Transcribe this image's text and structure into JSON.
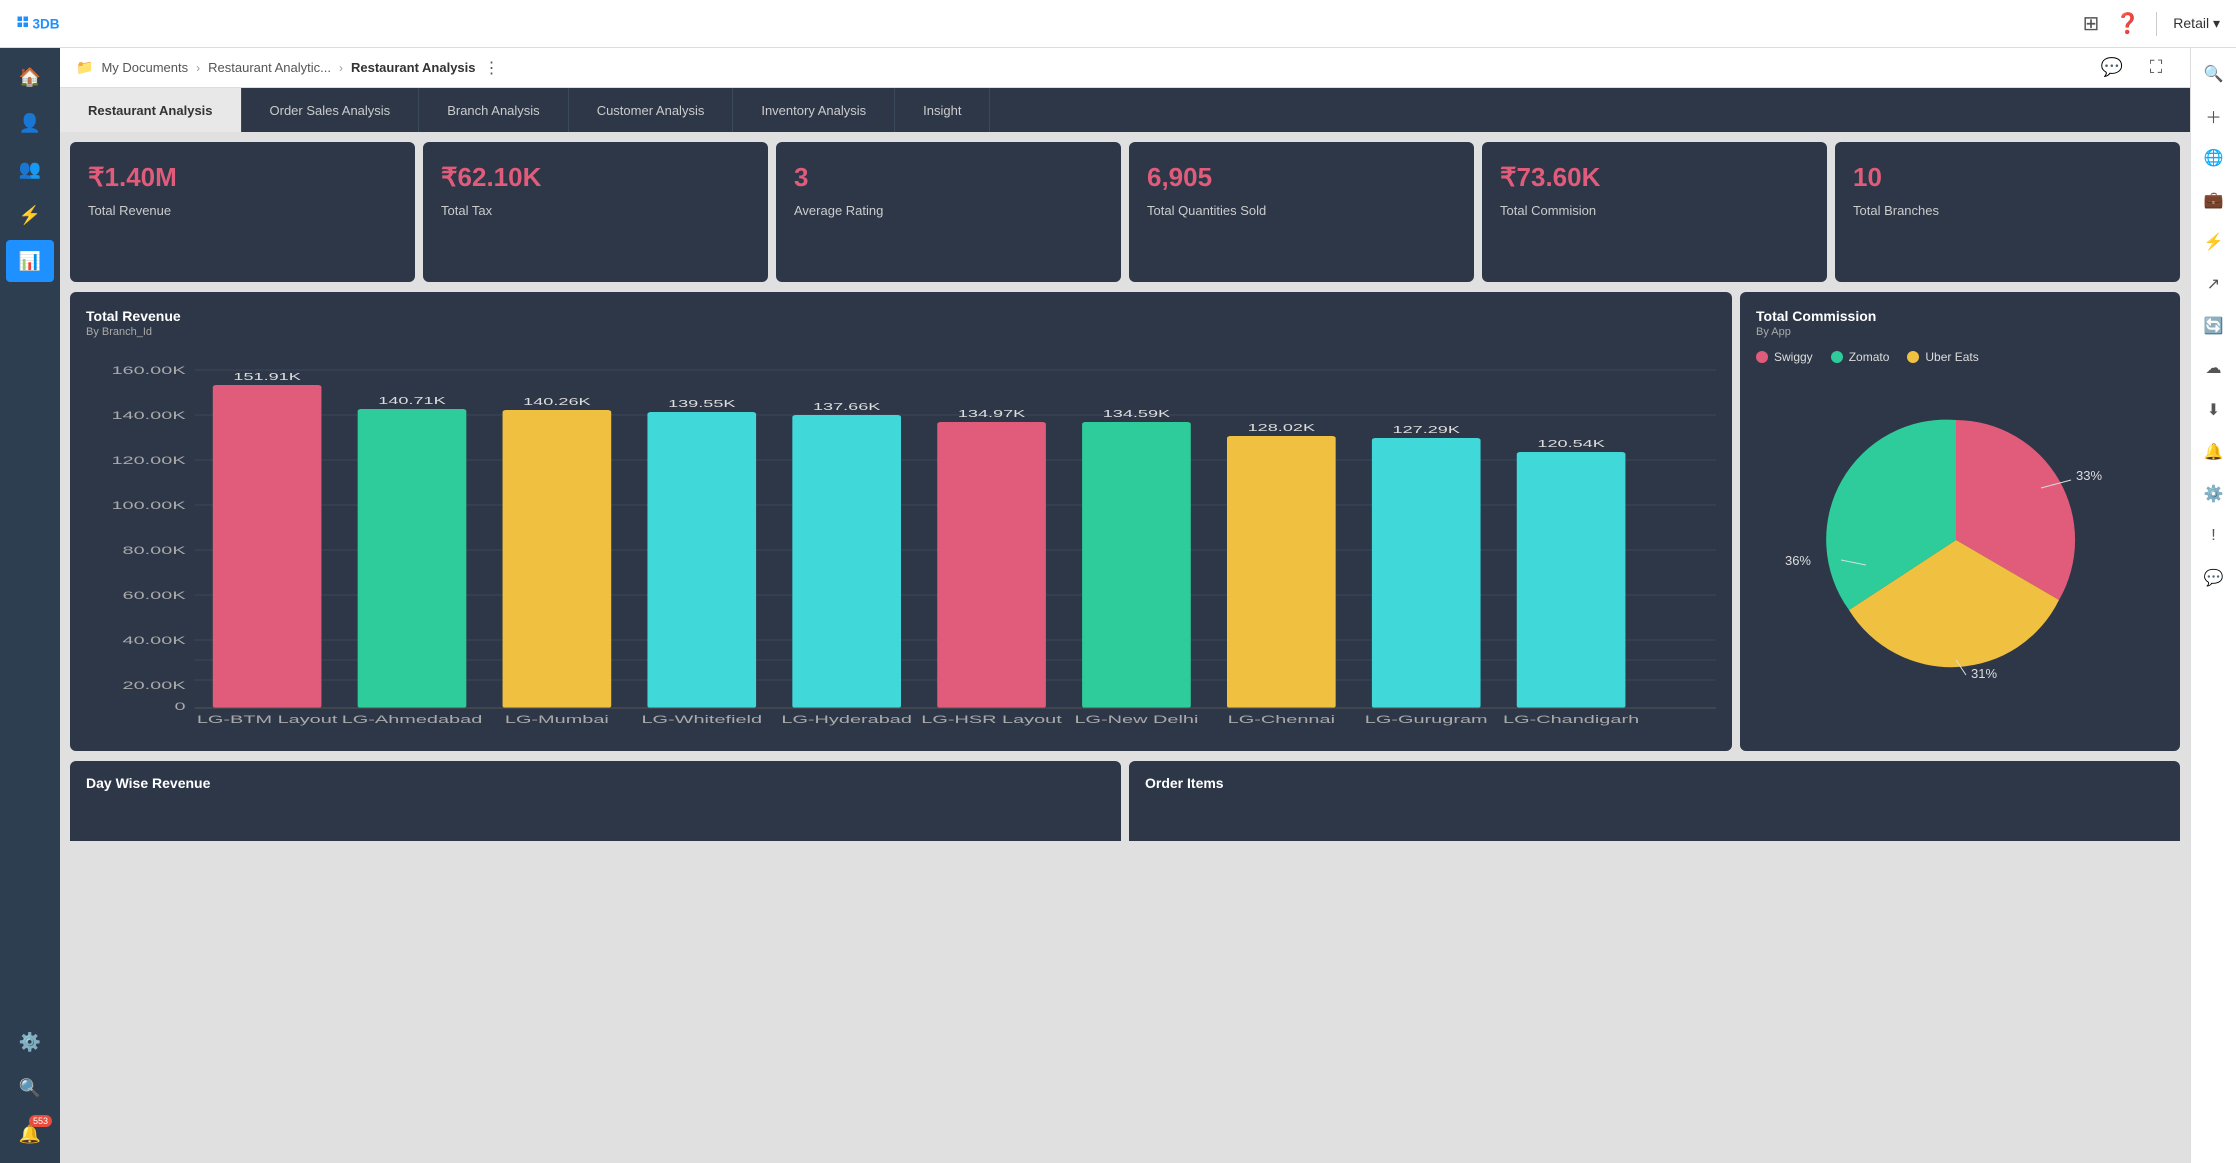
{
  "topNav": {
    "logo_alt": "3DB Logo",
    "icons": [
      "grid-icon",
      "help-icon"
    ],
    "divider": true,
    "retail_label": "Retail ▾"
  },
  "breadcrumb": {
    "folder_icon": "📁",
    "items": [
      "My Documents",
      "Restaurant Analytic...",
      "Restaurant Analysis"
    ],
    "more_icon": "⋮"
  },
  "tabs": [
    {
      "id": "restaurant",
      "label": "Restaurant Analysis",
      "active": true
    },
    {
      "id": "order-sales",
      "label": "Order Sales Analysis",
      "active": false
    },
    {
      "id": "branch",
      "label": "Branch Analysis",
      "active": false
    },
    {
      "id": "customer",
      "label": "Customer Analysis",
      "active": false
    },
    {
      "id": "inventory",
      "label": "Inventory Analysis",
      "active": false
    },
    {
      "id": "insight",
      "label": "Insight",
      "active": false
    }
  ],
  "kpiCards": [
    {
      "value": "₹1.40M",
      "label": "Total Revenue"
    },
    {
      "value": "₹62.10K",
      "label": "Total Tax"
    },
    {
      "value": "3",
      "label": "Average Rating"
    },
    {
      "value": "6,905",
      "label": "Total Quantities Sold"
    },
    {
      "value": "₹73.60K",
      "label": "Total Commision"
    },
    {
      "value": "10",
      "label": "Total Branches"
    }
  ],
  "barChart": {
    "title": "Total Revenue",
    "subtitle": "By Branch_Id",
    "bars": [
      {
        "label": "LG-BTM Layout",
        "value": 151.91,
        "color": "#e05c7a"
      },
      {
        "label": "LG-Ahmedabad",
        "value": 140.71,
        "color": "#2ecc9a"
      },
      {
        "label": "LG-Mumbai",
        "value": 140.26,
        "color": "#f0c040"
      },
      {
        "label": "LG-Whitefield",
        "value": 139.55,
        "color": "#40d8d8"
      },
      {
        "label": "LG-Hyderabad",
        "value": 137.66,
        "color": "#40d8d8"
      },
      {
        "label": "LG-HSR Layout",
        "value": 134.97,
        "color": "#e05c7a"
      },
      {
        "label": "LG-New Delhi",
        "value": 134.59,
        "color": "#2ecc9a"
      },
      {
        "label": "LG-Chennai",
        "value": 128.02,
        "color": "#f0c040"
      },
      {
        "label": "LG-Gurugram",
        "value": 127.29,
        "color": "#40d8d8"
      },
      {
        "label": "LG-Chandigarh",
        "value": 120.54,
        "color": "#40d8d8"
      }
    ],
    "yAxisLabels": [
      "0",
      "20.00K",
      "40.00K",
      "60.00K",
      "80.00K",
      "100.00K",
      "120.00K",
      "140.00K",
      "160.00K"
    ],
    "maxValue": 160
  },
  "pieChart": {
    "title": "Total Commission",
    "subtitle": "By App",
    "segments": [
      {
        "label": "Swiggy",
        "value": 33,
        "color": "#e05c7a"
      },
      {
        "label": "Zomato",
        "value": 31,
        "color": "#2ecc9a"
      },
      {
        "label": "Uber Eats",
        "value": 36,
        "color": "#f0c040"
      }
    ]
  },
  "bottomCards": [
    {
      "title": "Day Wise Revenue"
    },
    {
      "title": "Order Items"
    }
  ],
  "sidebar": {
    "items": [
      {
        "icon": "🏠",
        "name": "home",
        "active": false
      },
      {
        "icon": "👤",
        "name": "user",
        "active": false
      },
      {
        "icon": "👥",
        "name": "users",
        "active": false
      },
      {
        "icon": "⚡",
        "name": "data",
        "active": false
      },
      {
        "icon": "📊",
        "name": "dashboard",
        "active": true
      },
      {
        "icon": "🔔",
        "name": "notifications",
        "active": false,
        "badge": "553"
      },
      {
        "icon": "⚙️",
        "name": "settings",
        "active": false
      },
      {
        "icon": "🔍",
        "name": "search",
        "active": false
      }
    ]
  },
  "rightSidebar": {
    "items": [
      {
        "icon": "🔍",
        "name": "search"
      },
      {
        "icon": "+",
        "name": "add"
      },
      {
        "icon": "🌐",
        "name": "globe"
      },
      {
        "icon": "💼",
        "name": "briefcase"
      },
      {
        "icon": "⚡",
        "name": "filter"
      },
      {
        "icon": "↗",
        "name": "share"
      },
      {
        "icon": "🔄",
        "name": "refresh"
      },
      {
        "icon": "⬇",
        "name": "cloud-download"
      },
      {
        "icon": "⬇",
        "name": "download"
      },
      {
        "icon": "🔔",
        "name": "bell"
      },
      {
        "icon": "⚙️",
        "name": "settings2"
      },
      {
        "icon": "!",
        "name": "alert"
      },
      {
        "icon": "💬",
        "name": "chat"
      }
    ]
  }
}
